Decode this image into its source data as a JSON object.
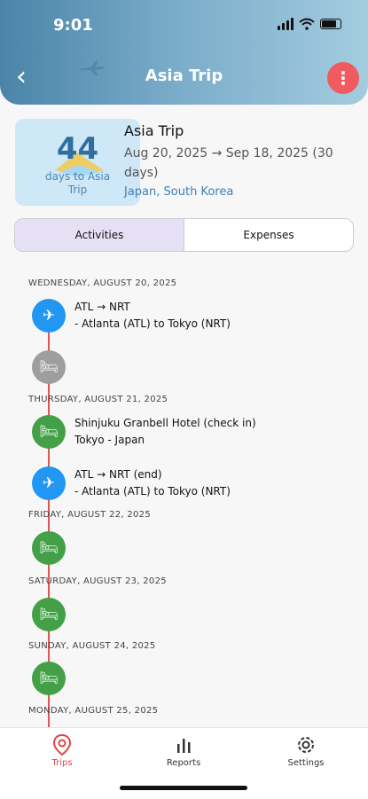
{
  "status": {
    "time": "9:01"
  },
  "header": {
    "title": "Asia Trip",
    "menu_icon": "⋮"
  },
  "trip": {
    "days": "44",
    "days_caption": "days to Asia Trip",
    "name": "Asia Trip",
    "dates": "Aug 20, 2025 → Sep 18, 2025 (30 days)",
    "places": "Japan, South Korea"
  },
  "tabs": {
    "activities": "Activities",
    "expenses": "Expenses"
  },
  "timeline": {
    "day1": "WEDNESDAY, AUGUST 20, 2025",
    "ev1_title": "ATL → NRT",
    "ev1_sub": " - Atlanta (ATL) to Tokyo (NRT)",
    "day2": "THURSDAY, AUGUST 21, 2025",
    "ev3_title": "Shinjuku Granbell Hotel (check in)",
    "ev3_sub": "Tokyo - Japan",
    "ev4_title": "ATL → NRT (end)",
    "ev4_sub": " - Atlanta (ATL) to Tokyo (NRT)",
    "day3": "FRIDAY, AUGUST 22, 2025",
    "day4": "SATURDAY, AUGUST 23, 2025",
    "day5": "SUNDAY, AUGUST 24, 2025",
    "day6": "MONDAY, AUGUST 25, 2025"
  },
  "nav": {
    "trips": "Trips",
    "reports": "Reports",
    "settings": "Settings"
  },
  "colors": {
    "accent": "#ef5b5f",
    "flight": "#2196f3",
    "hotel": "#43a047",
    "pending": "#9e9e9e",
    "line": "#e05555"
  }
}
